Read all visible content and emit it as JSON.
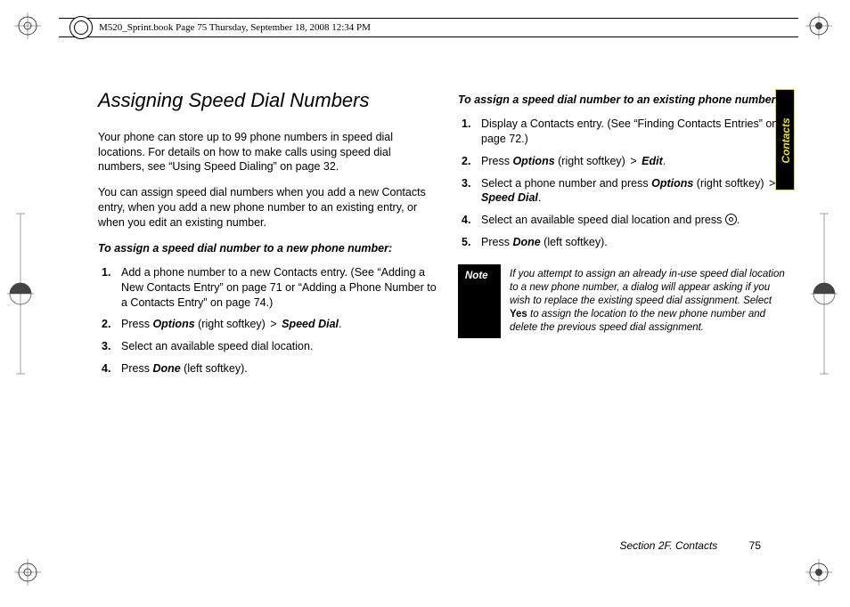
{
  "header": {
    "running_head": "M520_Sprint.book  Page 75  Thursday, September 18, 2008  12:34 PM"
  },
  "side_tab": {
    "label": "Contacts"
  },
  "title": "Assigning Speed Dial Numbers",
  "left": {
    "p1": "Your phone can store up to 99 phone numbers in speed dial locations. For details on how to make calls using speed dial numbers, see “Using Speed Dialing” on page 32.",
    "p2": "You can assign speed dial numbers when you add a new Contacts entry, when you add a new phone number to an existing entry, or when you edit an existing number.",
    "sub": "To assign a speed dial number to a new phone number:",
    "s1": "Add a phone number to a new Contacts entry. (See “Adding a New Contacts Entry” on page 71 or “Adding a Phone Number to a Contacts Entry” on page 74.)",
    "s2a": "Press ",
    "s2_options": "Options",
    "s2b": " (right softkey) ",
    "s2_speed": "Speed Dial",
    "s2c": ".",
    "s3": "Select an available speed dial location.",
    "s4a": "Press ",
    "s4_done": "Done",
    "s4b": " (left softkey)."
  },
  "right": {
    "sub": "To assign a speed dial number to an existing phone number:",
    "s1": "Display a Contacts entry. (See “Finding Contacts Entries” on page 72.)",
    "s2a": "Press ",
    "s2_options": "Options",
    "s2b": " (right softkey) ",
    "s2_edit": "Edit",
    "s2c": ".",
    "s3a": "Select a phone number and press ",
    "s3_options": "Options",
    "s3b": " (right softkey) ",
    "s3_speed": "Speed Dial",
    "s3c": ".",
    "s4a": "Select an available speed dial location and press ",
    "s4b": ".",
    "s5a": "Press ",
    "s5_done": "Done",
    "s5b": " (left softkey)."
  },
  "note": {
    "label": "Note",
    "t1": "If you attempt to assign an already in-use speed dial location to a new phone number, a dialog will appear asking if you wish to replace the existing speed dial assignment. Select ",
    "yes": "Yes",
    "t2": " to assign the location to the new phone number and delete the previous speed dial assignment."
  },
  "footer": {
    "section": "Section 2F. Contacts",
    "page": "75"
  }
}
